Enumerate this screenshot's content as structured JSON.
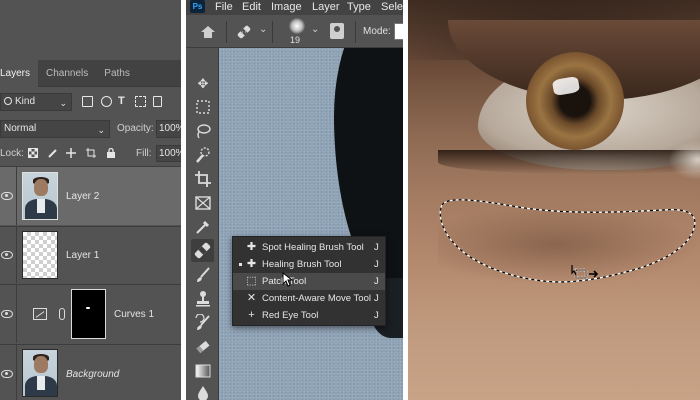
{
  "layers_panel": {
    "tabs": [
      "Layers",
      "Channels",
      "Paths"
    ],
    "filter_kind": "Kind",
    "blend_mode": "Normal",
    "opacity_label": "Opacity:",
    "opacity_value": "100%",
    "lock_label": "Lock:",
    "fill_label": "Fill:",
    "fill_value": "100%",
    "layers": [
      {
        "name": "Layer 2",
        "thumb": "photo",
        "visible": true,
        "selected": true
      },
      {
        "name": "Layer 1",
        "thumb": "transparent",
        "visible": true,
        "selected": false
      },
      {
        "name": "Curves 1",
        "thumb": "adjustment",
        "visible": true,
        "selected": false
      },
      {
        "name": "Background",
        "thumb": "photo",
        "visible": true,
        "selected": false,
        "italic": true
      }
    ]
  },
  "app": {
    "logo": "Ps",
    "menu": [
      "File",
      "Edit",
      "Image",
      "Layer",
      "Type",
      "Sele"
    ]
  },
  "options_bar": {
    "brush_size": "19",
    "mode_label": "Mode:"
  },
  "toolbar": {
    "tools": [
      "move-tool",
      "marquee-tool",
      "lasso-tool",
      "quick-selection-tool",
      "crop-tool",
      "frame-tool",
      "eyedropper-tool",
      "healing-brush-tool",
      "brush-tool",
      "clone-stamp-tool",
      "history-brush-tool",
      "eraser-tool",
      "gradient-tool",
      "blur-tool"
    ]
  },
  "flyout": {
    "items": [
      {
        "label": "Spot Healing Brush Tool",
        "shortcut": "J",
        "active": false,
        "highlighted": false,
        "icon": "spot-healing-icon"
      },
      {
        "label": "Healing Brush Tool",
        "shortcut": "J",
        "active": true,
        "highlighted": false,
        "icon": "healing-brush-icon"
      },
      {
        "label": "Patch Tool",
        "shortcut": "J",
        "active": false,
        "highlighted": true,
        "icon": "patch-icon"
      },
      {
        "label": "Content-Aware Move Tool",
        "shortcut": "J",
        "active": false,
        "highlighted": false,
        "icon": "content-aware-move-icon"
      },
      {
        "label": "Red Eye Tool",
        "shortcut": "J",
        "active": false,
        "highlighted": false,
        "icon": "red-eye-icon"
      }
    ]
  },
  "colors": {
    "panel_bg": "#535353",
    "flyout_bg": "#323232",
    "selected_layer_bg": "#6a6a6a"
  }
}
